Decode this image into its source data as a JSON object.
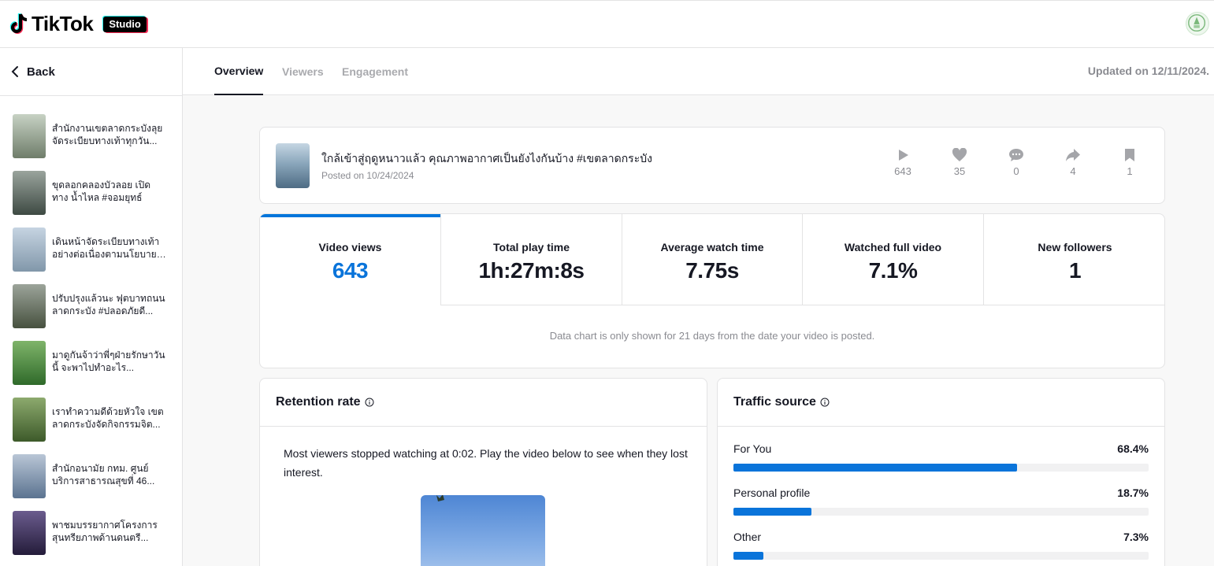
{
  "header": {
    "logo_text": "TikTok",
    "badge": "Studio"
  },
  "sidebar": {
    "back_label": "Back",
    "videos": [
      {
        "title": "สำนักงานเขตลาดกระบังลุย จัดระเบียบทางเท้าทุกวัน...",
        "thumb": [
          "#c7d2c4",
          "#6f7d6a"
        ]
      },
      {
        "title": "ขุดลอกคลองบัวลอย เปิดทาง น้ำไหล #จอมยุทธ์",
        "thumb": [
          "#9aa49d",
          "#3e4a43"
        ]
      },
      {
        "title": "เดินหน้าจัดระเบียบทางเท้า อย่างต่อเนื่องตามนโยบายผู้...",
        "thumb": [
          "#c6d4e2",
          "#8197aa"
        ]
      },
      {
        "title": "ปรับปรุงแล้วนะ ฟุตบาทถนน ลาดกระบัง #ปลอดภัยดี...",
        "thumb": [
          "#9ca49a",
          "#47513f"
        ]
      },
      {
        "title": "มาดูกันจ้าว่าพี่ๆฝ่ายรักษาวันนี้ จะพาไปทำอะไร...",
        "thumb": [
          "#7fb46a",
          "#2f6a2a"
        ]
      },
      {
        "title": "เราทำความดีด้วยหัวใจ เขต ลาดกระบังจัดกิจกรรมจิต...",
        "thumb": [
          "#8daa6e",
          "#3d5a2a"
        ]
      },
      {
        "title": "สำนักอนามัย กทม. ศูนย์ บริการสาธารณสุขที่ 46...",
        "thumb": [
          "#b9c6d6",
          "#5b7390"
        ]
      },
      {
        "title": "พาชมบรรยากาศโครงการ สุนทรียภาพด้านดนตรี...",
        "thumb": [
          "#6b5c8e",
          "#241c3a"
        ]
      }
    ]
  },
  "tabs": [
    {
      "label": "Overview",
      "active": true
    },
    {
      "label": "Viewers",
      "active": false
    },
    {
      "label": "Engagement",
      "active": false
    }
  ],
  "updated": "Updated on 12/11/2024.",
  "video": {
    "title": "ใกล้เข้าสู่ฤดูหนาวแล้ว คุณภาพอากาศเป็นยังไงกันบ้าง #เขตลาดกระบัง",
    "posted": "Posted on 10/24/2024",
    "stats": [
      {
        "icon": "play-icon",
        "value": "643"
      },
      {
        "icon": "heart-icon",
        "value": "35"
      },
      {
        "icon": "comment-icon",
        "value": "0"
      },
      {
        "icon": "share-icon",
        "value": "4"
      },
      {
        "icon": "bookmark-icon",
        "value": "1"
      }
    ]
  },
  "metrics": [
    {
      "label": "Video views",
      "value": "643",
      "active": true
    },
    {
      "label": "Total play time",
      "value": "1h:27m:8s",
      "active": false
    },
    {
      "label": "Average watch time",
      "value": "7.75s",
      "active": false
    },
    {
      "label": "Watched full video",
      "value": "7.1%",
      "active": false
    },
    {
      "label": "New followers",
      "value": "1",
      "active": false
    }
  ],
  "chart_note": "Data chart is only shown for 21 days from the date your video is posted.",
  "retention": {
    "title": "Retention rate",
    "text": "Most viewers stopped watching at 0:02. Play the video below to see when they lost interest."
  },
  "traffic": {
    "title": "Traffic source",
    "sources": [
      {
        "label": "For You",
        "pct": "68.4%",
        "value": 68.4
      },
      {
        "label": "Personal profile",
        "pct": "18.7%",
        "value": 18.7
      },
      {
        "label": "Other",
        "pct": "7.3%",
        "value": 7.3
      }
    ]
  },
  "colors": {
    "accent": "#0a74da",
    "text": "#161823",
    "muted": "#8a8b91",
    "border": "#e3e3e4"
  }
}
